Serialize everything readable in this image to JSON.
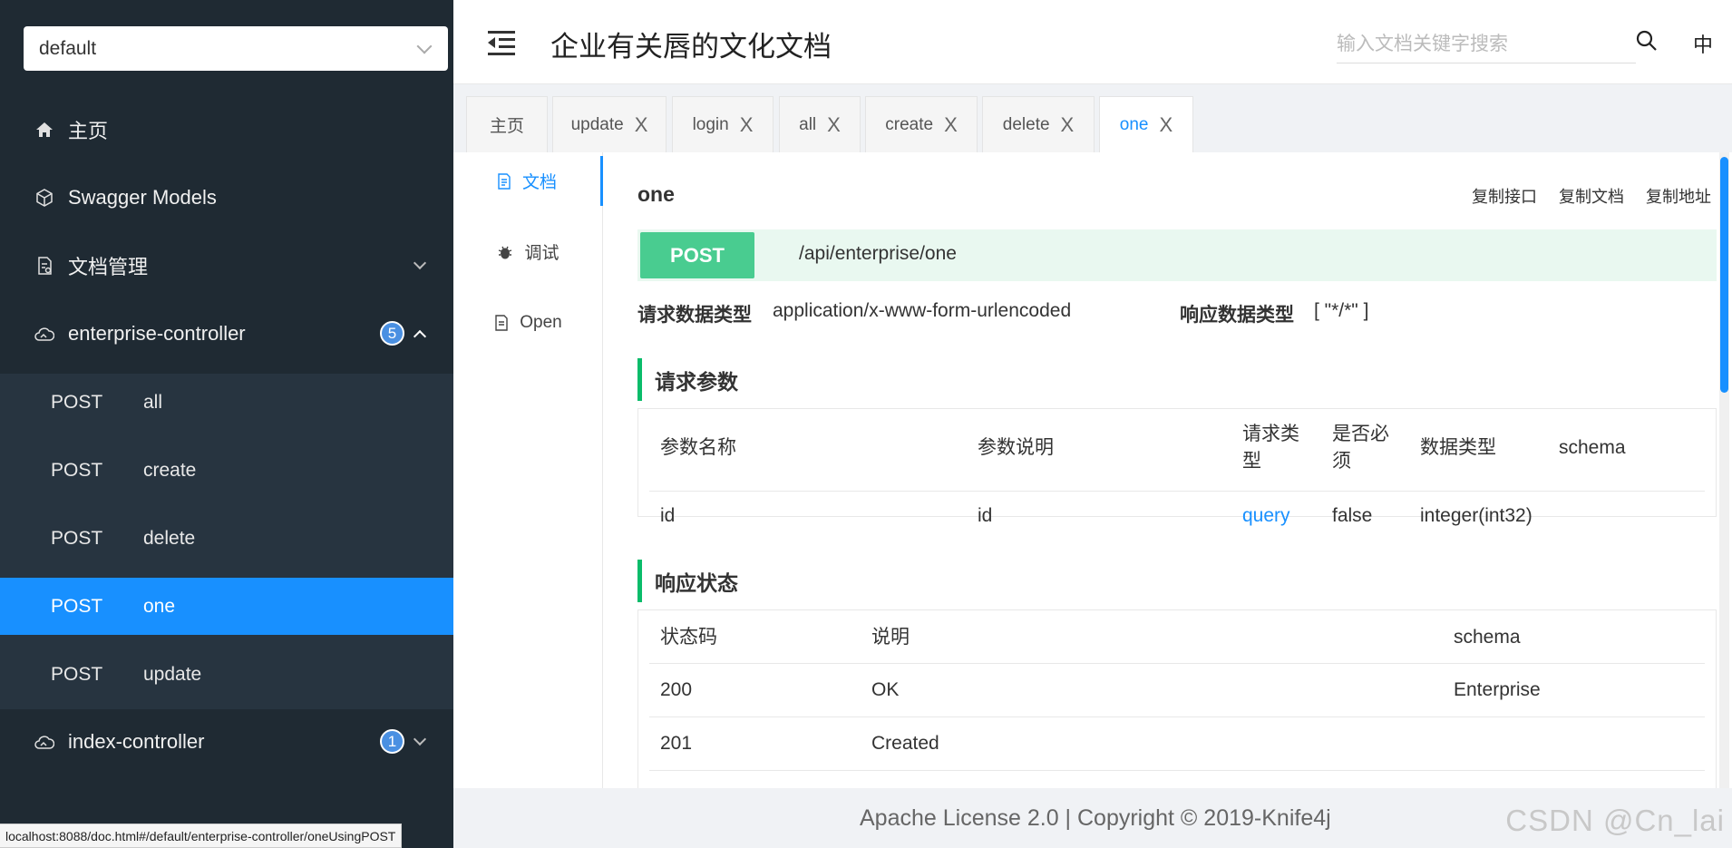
{
  "sidebar": {
    "group_select": "default",
    "nav": {
      "home": "主页",
      "models": "Swagger Models",
      "docs": "文档管理",
      "enterprise": "enterprise-controller",
      "enterprise_badge": "5",
      "index": "index-controller",
      "index_badge": "1"
    },
    "endpoints": [
      {
        "method": "POST",
        "name": "all"
      },
      {
        "method": "POST",
        "name": "create"
      },
      {
        "method": "POST",
        "name": "delete"
      },
      {
        "method": "POST",
        "name": "one"
      },
      {
        "method": "POST",
        "name": "update"
      }
    ]
  },
  "status_url": "localhost:8088/doc.html#/default/enterprise-controller/oneUsingPOST",
  "header": {
    "title": "企业有关唇的文化文档",
    "search_placeholder": "输入文档关键字搜索",
    "lang": "中"
  },
  "tabs": [
    "主页",
    "update",
    "login",
    "all",
    "create",
    "delete",
    "one"
  ],
  "tab_close": "X",
  "side_tabs": {
    "doc": "文档",
    "debug": "调试",
    "open": "Open"
  },
  "api": {
    "name": "one",
    "copy_api": "复制接口",
    "copy_doc": "复制文档",
    "copy_url": "复制地址",
    "method": "POST",
    "path": "/api/enterprise/one",
    "req_type_label": "请求数据类型",
    "req_type": "application/x-www-form-urlencoded",
    "resp_type_label": "响应数据类型",
    "resp_type": "[ \"*/*\" ]"
  },
  "params": {
    "title": "请求参数",
    "headers": {
      "name": "参数名称",
      "desc": "参数说明",
      "in_1": "请求类",
      "in_2": "型",
      "req_1": "是否必",
      "req_2": "须",
      "type": "数据类型",
      "schema": "schema"
    },
    "rows": [
      {
        "name": "id",
        "desc": "id",
        "in": "query",
        "required": "false",
        "type": "integer(int32)",
        "schema": ""
      }
    ]
  },
  "responses": {
    "title": "响应状态",
    "headers": {
      "code": "状态码",
      "desc": "说明",
      "schema": "schema"
    },
    "rows": [
      {
        "code": "200",
        "desc": "OK",
        "schema": "Enterprise"
      },
      {
        "code": "201",
        "desc": "Created",
        "schema": ""
      }
    ]
  },
  "footer": {
    "text": "Apache License 2.0 | Copyright © 2019-Knife4j",
    "watermark": "CSDN @Cn_lai"
  },
  "colors": {
    "accent": "#1890ff",
    "post": "#49cc90",
    "sidebar": "#1f2a33",
    "section_bar": "#09bc6a"
  }
}
